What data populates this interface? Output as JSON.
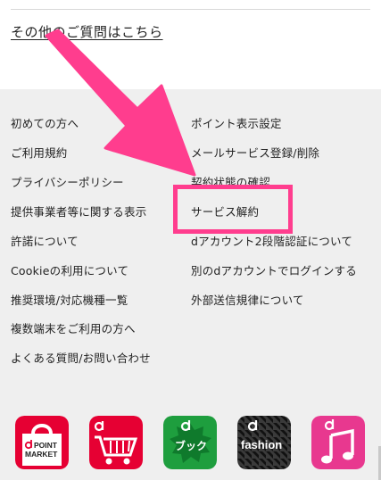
{
  "faq_link": "その他のご質問はこちら",
  "footer": {
    "left_links": [
      "初めての方へ",
      "ご利用規約",
      "プライバシーポリシー",
      "提供事業者等に関する表示",
      "許諾について",
      "Cookieの利用について",
      "推奨環境/対応機種一覧",
      "複数端末をご利用の方へ",
      "よくある質問/お問い合わせ"
    ],
    "right_links": [
      "ポイント表示設定",
      "メールサービス登録/削除",
      "契約状態の確認",
      "サービス解約",
      "dアカウント2段階認証について",
      "別のdアカウントでログインする",
      "外部送信規律について"
    ]
  },
  "annotation": {
    "color": "#ff3d8e",
    "target": "サービス解約"
  },
  "apps": [
    {
      "name": "d POINT MARKET",
      "line1": "POINT",
      "line2": "MARKET",
      "color": "#e60033"
    },
    {
      "name": "d shopping",
      "color": "#e60033"
    },
    {
      "name": "d book",
      "label": "ブック",
      "color": "#1e9e3e"
    },
    {
      "name": "d fashion",
      "label": "fashion",
      "color": "#222222"
    },
    {
      "name": "d music",
      "color": "#e8388f"
    }
  ]
}
